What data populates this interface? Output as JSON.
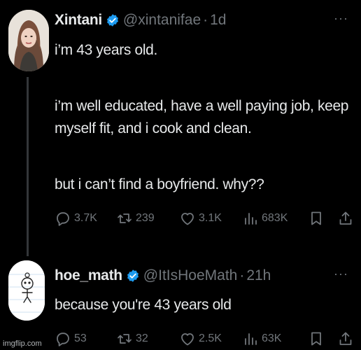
{
  "tweets": [
    {
      "author": {
        "display_name": "Xintani",
        "handle": "@xintanifae",
        "time": "1d",
        "verified": true
      },
      "lines": [
        "i’m 43 years old.",
        "i’m well educated, have a well paying job, keep",
        "myself fit, and i cook and clean.",
        "but i can’t find a boyfriend. why??"
      ],
      "stats": {
        "replies": "3.7K",
        "retweets": "239",
        "likes": "3.1K",
        "views": "683K"
      }
    },
    {
      "author": {
        "display_name": "hoe_math",
        "handle": "@ItIsHoeMath",
        "time": "21h",
        "verified": true
      },
      "lines": [
        "because you're 43 years old"
      ],
      "stats": {
        "replies": "53",
        "retweets": "32",
        "likes": "2.5K",
        "views": "63K"
      }
    }
  ],
  "separator": "·",
  "more_glyph": "···",
  "watermark": "imgflip.com",
  "colors": {
    "background": "#000000",
    "text": "#e7e9ea",
    "muted": "#71767b",
    "verified": "#1d9bf0"
  },
  "icons": [
    "reply-icon",
    "retweet-icon",
    "like-icon",
    "views-icon",
    "bookmark-icon",
    "share-icon",
    "verified-icon",
    "more-icon"
  ]
}
